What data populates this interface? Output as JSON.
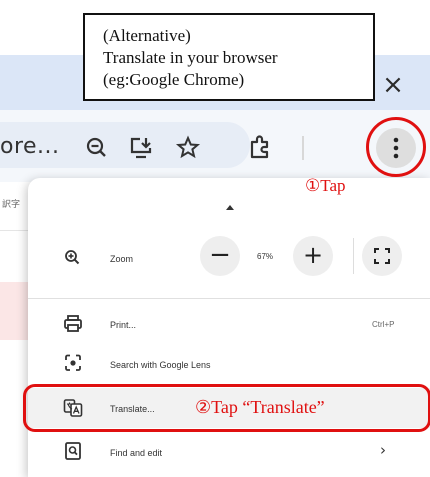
{
  "browser": {
    "tab_close": "×",
    "omnibox_text": "ore...",
    "page_fragment": "訳字"
  },
  "menu": {
    "zoom": {
      "label": "Zoom",
      "minus": "−",
      "value": "67%",
      "plus": "+"
    },
    "items": [
      {
        "label": "Print...",
        "shortcut": "Ctrl+P"
      },
      {
        "label": "Search with Google Lens"
      },
      {
        "label": "Translate..."
      },
      {
        "label": "Find and edit",
        "chevron": "›"
      }
    ]
  },
  "annotations": {
    "callout_lines": [
      "(Alternative)",
      "Translate in your browser",
      "(eg:Google Chrome)"
    ],
    "tap1": "①Tap",
    "tap2": "②Tap “Translate”"
  },
  "colors": {
    "annotation_red": "#e01010",
    "tabstrip": "#dbe6f7",
    "toolbar": "#f4f7fb"
  },
  "icons": [
    "zoom-out-icon",
    "install-app-icon",
    "bookmark-star-icon",
    "extensions-icon",
    "kebab-menu-icon",
    "zoom-icon",
    "fullscreen-icon",
    "print-icon",
    "google-lens-icon",
    "translate-icon",
    "find-icon"
  ]
}
